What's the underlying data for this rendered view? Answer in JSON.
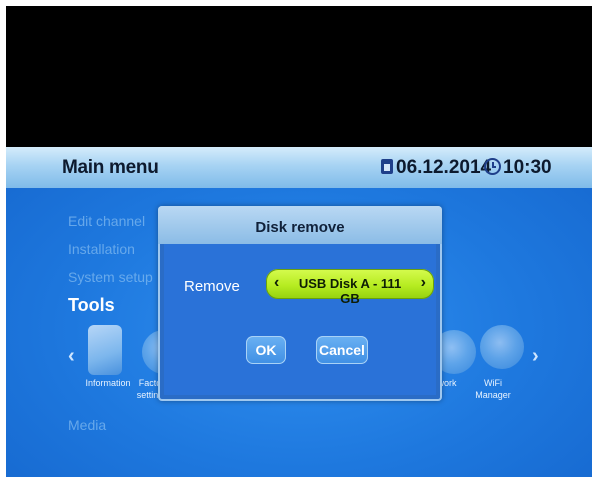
{
  "header": {
    "title": "Main menu",
    "date": "06.12.2014",
    "time": "10:30",
    "calendar_icon": "calendar-icon",
    "clock_icon": "clock-icon"
  },
  "menu": {
    "items": [
      {
        "label": "Edit channel"
      },
      {
        "label": "Installation"
      },
      {
        "label": "System setup"
      },
      {
        "label": "Tools",
        "active": true
      },
      {
        "label": "Media"
      }
    ]
  },
  "carousel": {
    "left_arrow": "‹",
    "right_arrow": "›",
    "items": [
      {
        "label": "Information",
        "icon": "information-icon"
      },
      {
        "label": "Facto\nsetting",
        "icon": "factory-icon"
      },
      {
        "label": "work",
        "icon": "network-icon"
      },
      {
        "label": "WiFi\nManager",
        "icon": "wifi-icon"
      }
    ]
  },
  "dialog": {
    "title": "Disk remove",
    "field_label": "Remove",
    "selector_value": "USB Disk A - 111 GB",
    "selector_left": "‹",
    "selector_right": "›",
    "ok_label": "OK",
    "cancel_label": "Cancel"
  },
  "colors": {
    "accent": "#2a72d8",
    "selector": "#b6ec21",
    "header": "#a7d3f3"
  }
}
